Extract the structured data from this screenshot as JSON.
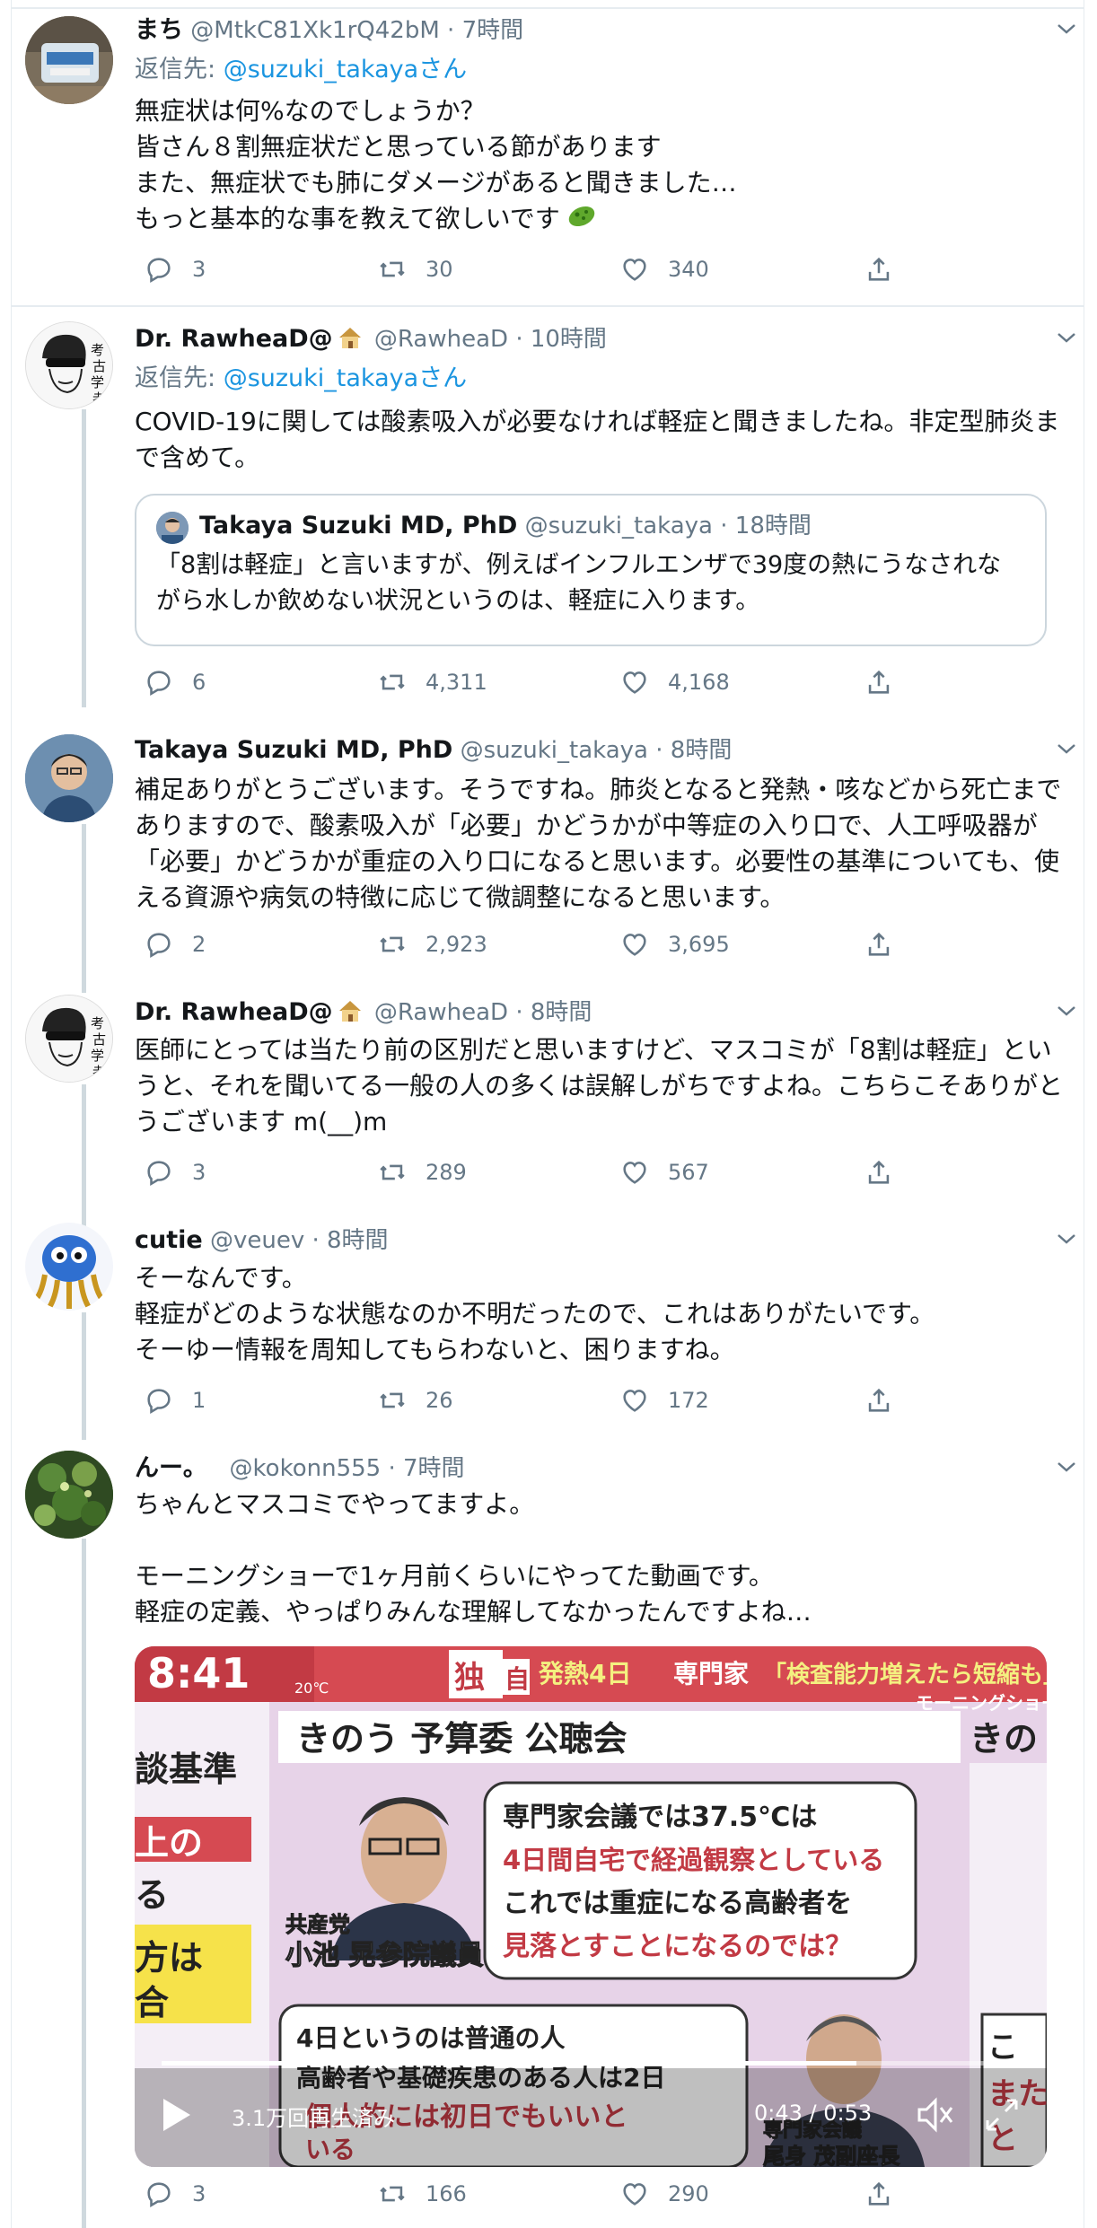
{
  "tweets": [
    {
      "name": "まち",
      "handle": "@MtkC81Xk1rQ42bM",
      "time": "· 7時間",
      "reply_prefix": "返信先: ",
      "reply_to": "@suzuki_takaya",
      "reply_suffix": "さん",
      "text": "無症状は何%なのでしょうか？\n皆さん８割無症状だと思っている節があります\nまた、無症状でも肺にダメージがあると聞きました…\nもっと基本的な事を教えて欲しいです",
      "emoji": "microbe-emoji",
      "replies": "3",
      "retweets": "30",
      "likes": "340"
    },
    {
      "name": "Dr. RawheaD@",
      "handle": "@RawheaD",
      "time": "· 10時間",
      "reply_prefix": "返信先: ",
      "reply_to": "@suzuki_takaya",
      "reply_suffix": "さん",
      "text": "COVID-19に関しては酸素吸入が必要なければ軽症と聞きましたね。非定型肺炎まで含めて。",
      "quote": {
        "name": "Takaya Suzuki MD, PhD",
        "handle": "@suzuki_takaya",
        "time": "· 18時間",
        "text": "「8割は軽症」と言いますが、例えばインフルエンザで39度の熱にうなされながら水しか飲めない状況というのは、軽症に入ります。"
      },
      "replies": "6",
      "retweets": "4,311",
      "likes": "4,168"
    },
    {
      "name": "Takaya Suzuki MD, PhD",
      "handle": "@suzuki_takaya",
      "time": "· 8時間",
      "text": "補足ありがとうございます。そうですね。肺炎となると発熱・咳などから死亡までありますので、酸素吸入が「必要」かどうかが中等症の入り口で、人工呼吸器が「必要」かどうかが重症の入り口になると思います。必要性の基準についても、使える資源や病気の特徴に応じて微調整になると思います。",
      "replies": "2",
      "retweets": "2,923",
      "likes": "3,695"
    },
    {
      "name": "Dr. RawheaD@",
      "handle": "@RawheaD",
      "time": "· 8時間",
      "text": "医師にとっては当たり前の区別だと思いますけど、マスコミが「8割は軽症」というと、それを聞いてる一般の人の多くは誤解しがちですよね。こちらこそありがとうございます m(__)m",
      "replies": "3",
      "retweets": "289",
      "likes": "567"
    },
    {
      "name": "cutie",
      "handle": "@veuev",
      "time": "· 8時間",
      "text": "そーなんです。\n軽症がどのような状態なのか不明だったので、これはありがたいです。\nそーゆー情報を周知してもらわないと、困りますね。",
      "replies": "1",
      "retweets": "26",
      "likes": "172"
    },
    {
      "name": "んー。",
      "handle": "@kokonn555",
      "time": "· 7時間",
      "text": "ちゃんとマスコミでやってますよ。\n\nモーニングショーで1ヶ月前くらいにやってた動画です。\n軽症の定義、やっぱりみんな理解してなかったんですよね…",
      "replies": "3",
      "retweets": "166",
      "likes": "290",
      "video": {
        "clock": "8:41",
        "temp": "20℃",
        "headline_a": "独",
        "headline_b": "自",
        "headline_c": "発熱4日",
        "headline_d": "専門家",
        "headline_e": "「検査能力増えたら短縮も」",
        "show": "モーニングショー",
        "left_1": "談基準",
        "left_2": "上の",
        "left_3": "る",
        "left_4": "方は",
        "left_5": "合",
        "banner": "きのう 予算委 公聴会",
        "right_top": "きの",
        "party": "共産党",
        "politician": "小池 晃参院議員",
        "bubble_line1": "専門家会議では37.5℃は",
        "bubble_line2": "4日間自宅で経過観察としている",
        "bubble_line3": "これでは重症になる高齢者を",
        "bubble_line4": "見落とすことになるのでは？",
        "answer_line1": "4日というのは普通の人",
        "answer_line2": "高齢者や基礎疾患のある人は2日",
        "answer_line3": "個人的には初日でもいいと",
        "answer_line4": "いる",
        "expert_caption": "専門家会議",
        "expert_name": "尾身 茂副座長",
        "right_side_1": "こ",
        "right_side_2": "また",
        "right_side_3": "と",
        "views": "3.1万回再生済み",
        "time": "0:43 / 0:53",
        "progress": 0.81
      }
    }
  ]
}
